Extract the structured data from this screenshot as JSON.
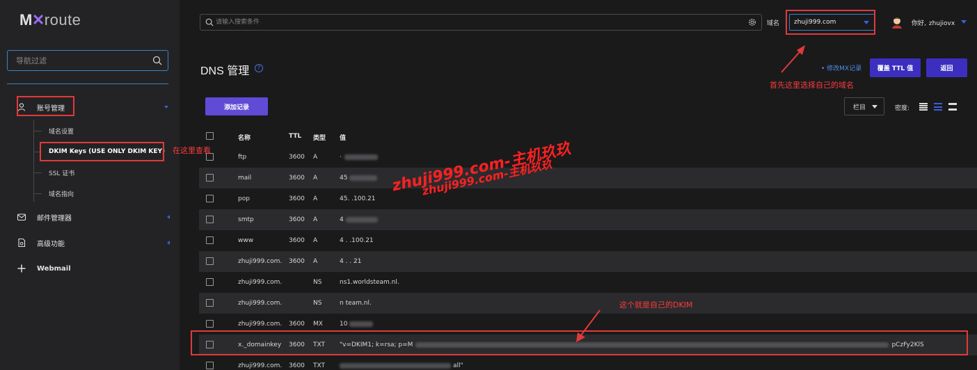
{
  "logo": {
    "prefix": "M",
    "x": "✕",
    "suffix": "route"
  },
  "sidebar": {
    "filter_placeholder": "导航过滤",
    "account": {
      "label": "账号管理"
    },
    "sub_items": [
      "域名设置",
      "DKIM Keys (USE ONLY DKIM KEY)",
      "SSL 证书",
      "域名指向"
    ],
    "mail_manager": {
      "label": "邮件管理器"
    },
    "advanced": {
      "label": "高级功能"
    },
    "webmail": {
      "label": "Webmail"
    }
  },
  "topbar": {
    "search_placeholder": "请输入搜索条件",
    "domain_label": "域名",
    "domain_value": "zhuji999.com",
    "greeting": "你好,",
    "username": "zhujiovx"
  },
  "header": {
    "title": "DNS 管理",
    "mx_link": "• 修改MX记录",
    "override_ttl": "覆盖 TTL 值",
    "back": "返回",
    "add_record": "添加记录",
    "columns": "栏目",
    "density": "密度:"
  },
  "table": {
    "headers": {
      "name": "名称",
      "ttl": "TTL",
      "type": "类型",
      "value": "值"
    },
    "rows": [
      {
        "name": "ftp",
        "ttl": "3600",
        "type": "A",
        "value": "·"
      },
      {
        "name": "mail",
        "ttl": "3600",
        "type": "A",
        "value": "45"
      },
      {
        "name": "pop",
        "ttl": "3600",
        "type": "A",
        "value": "45.  .100.21"
      },
      {
        "name": "smtp",
        "ttl": "3600",
        "type": "A",
        "value": "4"
      },
      {
        "name": "www",
        "ttl": "3600",
        "type": "A",
        "value": "4  .  .100.21"
      },
      {
        "name": "zhuji999.com.",
        "ttl": "3600",
        "type": "A",
        "value": "4  .  .  21"
      },
      {
        "name": "zhuji999.com.",
        "ttl": "",
        "type": "NS",
        "value": "ns1.worldsteam.nl."
      },
      {
        "name": "zhuji999.com.",
        "ttl": "",
        "type": "NS",
        "value": "n       team.nl."
      },
      {
        "name": "zhuji999.com.",
        "ttl": "3600",
        "type": "MX",
        "value": "10"
      },
      {
        "name": "x._domainkey",
        "ttl": "3600",
        "type": "TXT",
        "value_start": "\"v=DKIM1; k=rsa; p=M",
        "value_end": "pCzFy2KlS"
      },
      {
        "name": "zhuji999.com.",
        "ttl": "3600",
        "type": "TXT",
        "value": "all\""
      }
    ]
  },
  "annotations": {
    "view_here": "在这里查看",
    "select_domain": "首先这里选择自己的域名",
    "this_is_dkim": "这个就是自己的DKIM",
    "watermark": "zhuji999.com-主机玖玖"
  },
  "colors": {
    "accent": "#3c2fbf",
    "link": "#4f8fe6",
    "annotation": "#e23a3a"
  }
}
